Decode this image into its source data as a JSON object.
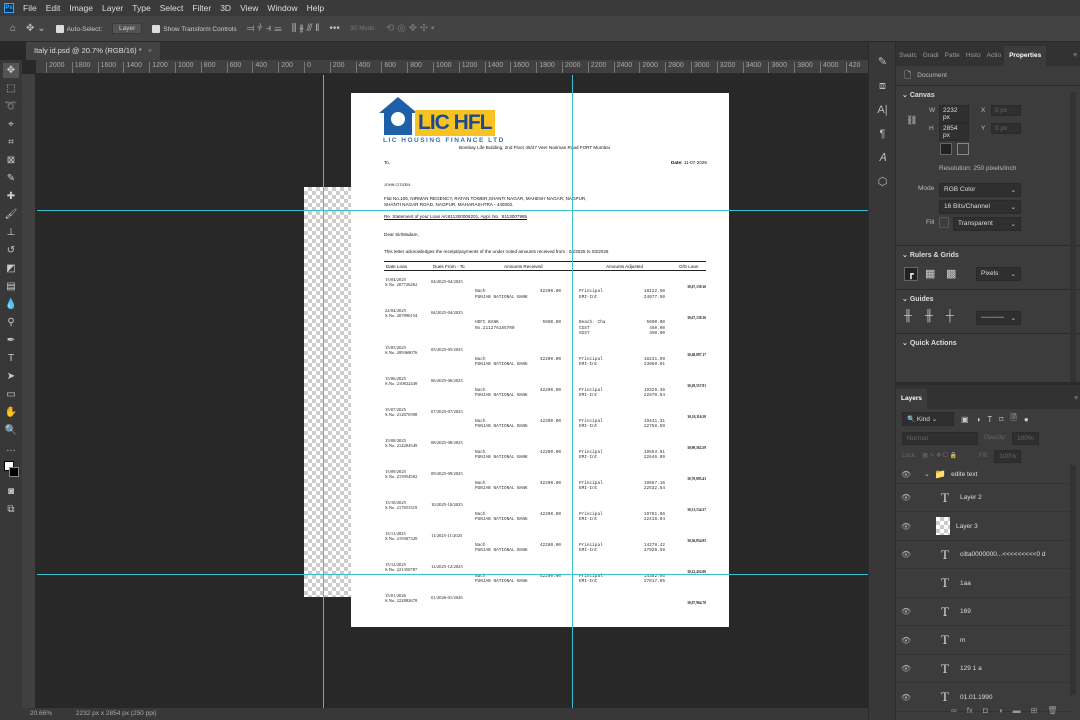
{
  "app": {
    "menu": [
      "File",
      "Edit",
      "Image",
      "Layer",
      "Type",
      "Select",
      "Filter",
      "3D",
      "View",
      "Window",
      "Help"
    ]
  },
  "options": {
    "auto_select": "Auto-Select:",
    "layer_select": "Layer",
    "show_transform": "Show Transform Controls",
    "mode_3d": "3D Mode:"
  },
  "doc_tab": {
    "title": "Italy id.psd @ 20.7% (RGB/16) *",
    "close": "×"
  },
  "ruler": {
    "top": [
      "2000",
      "1800",
      "1600",
      "1400",
      "1200",
      "1000",
      "800",
      "600",
      "400",
      "200",
      "0",
      "200",
      "400",
      "600",
      "800",
      "1000",
      "1200",
      "1400",
      "1600",
      "1800",
      "2000",
      "2200",
      "2400",
      "2600",
      "2800",
      "3000",
      "3200",
      "3400",
      "3600",
      "3800",
      "4000",
      "420"
    ]
  },
  "status": {
    "zoom": "20.66%",
    "dims": "2232 px x 2854 px (250 ppi)"
  },
  "letter": {
    "logo": "LIC HFL",
    "company": "LIC HOUSING FINANCE LTD",
    "address": "Bombay Life Building, 2nd Floor 45/47 Veer Nariman Road FORT Mumbai",
    "to": "To,",
    "date_label": "Date:",
    "date": "11-07-2026",
    "name": "JOHN CITIZEN.",
    "addr1": "Flat No.106, NIRMAN REGENCY, RATAN TOWER,SHANTI NAGAR, MAHESH NAGAR, NAGPUR,",
    "addr2": "SHANTI NAGAR ROAD, NAGPUR, MAHARASHTRA - 440002.",
    "re": "Re. Statement of your Loan A/c611300006201, Appl. No. :6113007985",
    "salutation": "Dear Sir/Madam,",
    "intro": "This letter acknowledges the receipt/payments of the under noted amounts received from : 04/2025 to 03/2026",
    "headers": [
      "Date Loan",
      "Dues From - To",
      "Amounts Received",
      "Amounts Adjusted",
      "O/S Loan"
    ],
    "rows": [
      {
        "date": "15/04/2025",
        "sno": "S.No. 207726262",
        "dues": "04/2025-04/2025",
        "recv": [
          [
            "Nach",
            "42200.00"
          ],
          [
            "PUNJAB NATIONAL BANK",
            ""
          ]
        ],
        "adj": [
          [
            "Principal",
            "18122.50"
          ],
          [
            "EMI-Int",
            "24077.50"
          ]
        ],
        "os": "30,67,139.16"
      },
      {
        "date": "22/04/2025",
        "sno": "S.No. 207890154",
        "dues": "04/2025-04/2025",
        "recv": [
          [
            "HDFC BANK",
            "5900.00"
          ],
          [
            "No.211276185700",
            ""
          ]
        ],
        "adj": [
          [
            "Beach. Cha",
            "5000.00"
          ],
          [
            "CGST",
            "450.00"
          ],
          [
            "SGST",
            "450.00"
          ]
        ],
        "os": "30,67,139.16"
      },
      {
        "date": "15/05/2025",
        "sno": "S.No. 209368076",
        "dues": "05/2025-05/2025",
        "recv": [
          [
            "Nach",
            "42200.00"
          ],
          [
            "PUNJAB NATIONAL BANK",
            ""
          ]
        ],
        "adj": [
          [
            "Principal",
            "18231.99"
          ],
          [
            "EMI-Int",
            "23968.01"
          ]
        ],
        "os": "30,48,887.17"
      },
      {
        "date": "15/06/2025",
        "sno": "S.No. 210822449",
        "dues": "06/2025-06/2025",
        "recv": [
          [
            "Nach",
            "42200.00"
          ],
          [
            "PUNJAB NATIONAL BANK",
            ""
          ]
        ],
        "adj": [
          [
            "Principal",
            "19329.36"
          ],
          [
            "EMI-Int",
            "22870.64"
          ]
        ],
        "os": "30,29,557.81"
      },
      {
        "date": "15/07/2025",
        "sno": "S.No. 212670398",
        "dues": "07/2025-07/2025",
        "recv": [
          [
            "Nach",
            "42200.00"
          ],
          [
            "PUNJAB NATIONAL BANK",
            ""
          ]
        ],
        "adj": [
          [
            "Principal",
            "19441.31"
          ],
          [
            "EMI-Int",
            "22758.69"
          ]
        ],
        "os": "30,10,116.50"
      },
      {
        "date": "15/08/2025",
        "sno": "S.No. 214284549",
        "dues": "08/2025-08/2025",
        "recv": [
          [
            "Nach",
            "42200.00"
          ],
          [
            "PUNJAB NATIONAL BANK",
            ""
          ]
        ],
        "adj": [
          [
            "Principal",
            "19553.91"
          ],
          [
            "EMI-Int",
            "22646.09"
          ]
        ],
        "os": "30,90,562.59"
      },
      {
        "date": "15/09/2025",
        "sno": "S.No. 215954502",
        "dues": "09/2025-09/2025",
        "recv": [
          [
            "Nach",
            "42200.00"
          ],
          [
            "PUNJAB NATIONAL BANK",
            ""
          ]
        ],
        "adj": [
          [
            "Principal",
            "19667.16"
          ],
          [
            "EMI-Int",
            "22532.84"
          ]
        ],
        "os": "30,70,895.43"
      },
      {
        "date": "15/10/2025",
        "sno": "S.No. 217653319",
        "dues": "10/2025-10/2025",
        "recv": [
          [
            "Nach",
            "42200.00"
          ],
          [
            "PUNJAB NATIONAL BANK",
            ""
          ]
        ],
        "adj": [
          [
            "Principal",
            "19781.06"
          ],
          [
            "EMI-Int",
            "22418.94"
          ]
        ],
        "os": "30,51,134.37"
      },
      {
        "date": "15/11/2025",
        "sno": "S.No. 219307320",
        "dues": "11/2025-11/2025",
        "recv": [
          [
            "Nach",
            "42200.00"
          ],
          [
            "PUNJAB NATIONAL BANK",
            ""
          ]
        ],
        "adj": [
          [
            "Principal",
            "14279.42"
          ],
          [
            "EMI-Int",
            "27920.58"
          ]
        ],
        "os": "30,36,854.95"
      },
      {
        "date": "15/12/2025",
        "sno": "S.No. 221350787",
        "dues": "12/2025-12/2025",
        "recv": [
          [
            "Nach",
            "42200.00"
          ],
          [
            "PUNJAB NATIONAL BANK",
            ""
          ]
        ],
        "adj": [
          [
            "Principal",
            "14382.95"
          ],
          [
            "EMI-Int",
            "27817.05"
          ]
        ],
        "os": "30,22,452.00"
      },
      {
        "date": "15/01/2026",
        "sno": "S.No. 222882678",
        "dues": "01/2026-01/2026",
        "recv": [],
        "adj": [],
        "os": "30,07,964.78"
      }
    ]
  },
  "properties": {
    "tabs": [
      "Swatc",
      "Gradi",
      "Patte",
      "Histo",
      "Actio",
      "Properties"
    ],
    "document": "Document",
    "canvas": "Canvas",
    "w_label": "W",
    "w": "2232 px",
    "h_label": "H",
    "h": "2854 px",
    "x_label": "X",
    "x": "0 px",
    "y_label": "Y",
    "y": "0 px",
    "resolution": "Resolution: 250 pixels/inch",
    "mode_label": "Mode",
    "mode": "RGB Color",
    "depth": "16 Bits/Channel",
    "fill_label": "Fill",
    "fill": "Transparent",
    "rulers": "Rulers & Grids",
    "units": "Pixels",
    "guides": "Guides",
    "quick": "Quick Actions"
  },
  "layers": {
    "title": "Layers",
    "kind": "Kind",
    "blend": "Normal",
    "opacity_label": "Opacity:",
    "opacity": "100%",
    "lock_label": "Lock:",
    "fill_label": "Fill:",
    "fill": "100%",
    "items": [
      {
        "name": "edite text",
        "type": "group",
        "visible": true
      },
      {
        "name": "Layer 2",
        "type": "text",
        "visible": true
      },
      {
        "name": "Layer 3",
        "type": "image",
        "visible": true
      },
      {
        "name": "cilta0000000...<<<<<<<<<0 d",
        "type": "text",
        "visible": true
      },
      {
        "name": "1aa",
        "type": "text",
        "visible": false
      },
      {
        "name": "169",
        "type": "text",
        "visible": true
      },
      {
        "name": "m",
        "type": "text",
        "visible": true
      },
      {
        "name": "129 1 a",
        "type": "text",
        "visible": true
      },
      {
        "name": "01.01.1990",
        "type": "text",
        "visible": true
      }
    ]
  }
}
